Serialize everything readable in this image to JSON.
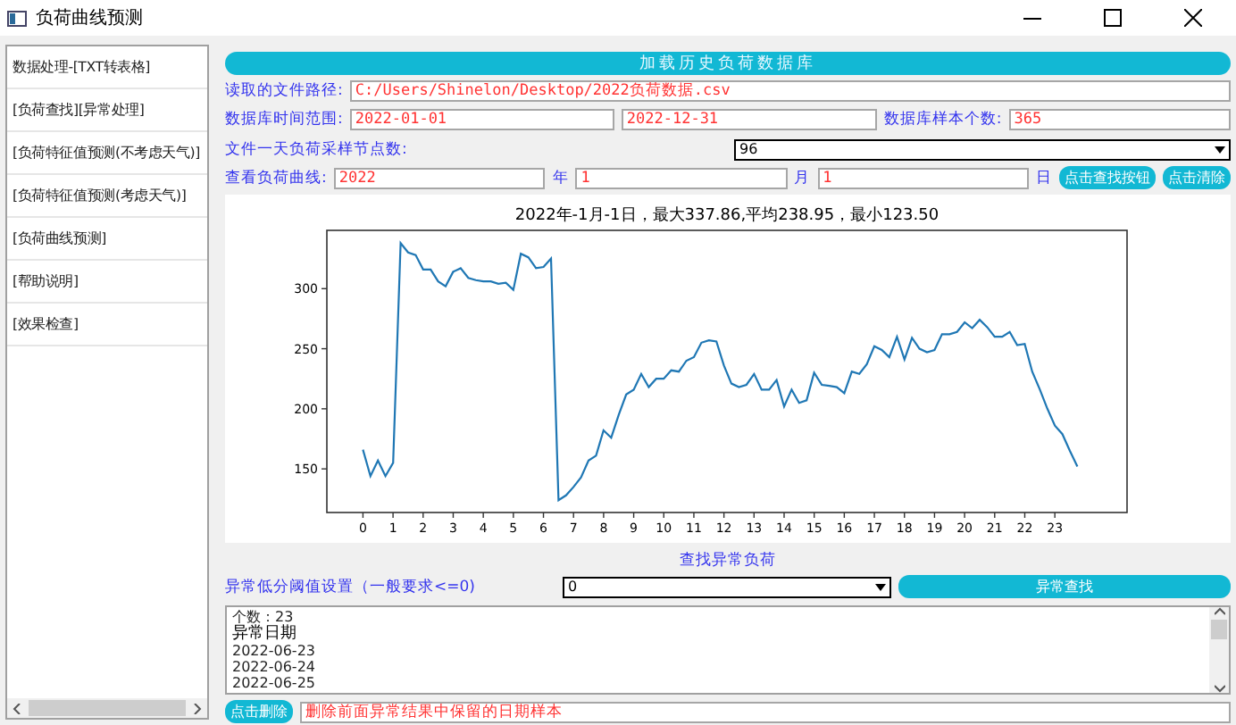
{
  "window": {
    "title": "负荷曲线预测"
  },
  "sidebar": {
    "items": [
      {
        "label": "数据处理-[TXT转表格]"
      },
      {
        "label": "[负荷查找][异常处理]"
      },
      {
        "label": "[负荷特征值预测(不考虑天气)]"
      },
      {
        "label": "[负荷特征值预测(考虑天气)]"
      },
      {
        "label": "[负荷曲线预测]"
      },
      {
        "label": "[帮助说明]"
      },
      {
        "label": "[效果检查]"
      }
    ]
  },
  "load_button": "加载历史负荷数据库",
  "file_path": {
    "label": "读取的文件路径:",
    "value": "C:/Users/Shinelon/Desktop/2022负荷数据.csv"
  },
  "date_range": {
    "label": "数据库时间范围:",
    "start": "2022-01-01",
    "end": "2022-12-31"
  },
  "sample_count": {
    "label": "数据库样本个数:",
    "value": "365"
  },
  "nodes": {
    "label": "文件一天负荷采样节点数:",
    "value": "96"
  },
  "curve": {
    "label": "查看负荷曲线:",
    "year": "2022",
    "year_unit": "年",
    "month": "1",
    "month_unit": "月",
    "day": "1",
    "day_unit": "日",
    "find_button": "点击查找按钮",
    "clear_button": "点击清除"
  },
  "chart": {
    "chart_data": {
      "type": "line",
      "title": "2022年-1月-1日，最大337.86,平均238.95，最小123.50",
      "x": [
        0,
        0.25,
        0.5,
        0.75,
        1,
        1.25,
        1.5,
        1.75,
        2,
        2.25,
        2.5,
        2.75,
        3,
        3.25,
        3.5,
        3.75,
        4,
        4.25,
        4.5,
        4.75,
        5,
        5.25,
        5.5,
        5.75,
        6,
        6.25,
        6.5,
        6.75,
        7,
        7.25,
        7.5,
        7.75,
        8,
        8.25,
        8.5,
        8.75,
        9,
        9.25,
        9.5,
        9.75,
        10,
        10.25,
        10.5,
        10.75,
        11,
        11.25,
        11.5,
        11.75,
        12,
        12.25,
        12.5,
        12.75,
        13,
        13.25,
        13.5,
        13.75,
        14,
        14.25,
        14.5,
        14.75,
        15,
        15.25,
        15.5,
        15.75,
        16,
        16.25,
        16.5,
        16.75,
        17,
        17.25,
        17.5,
        17.75,
        18,
        18.25,
        18.5,
        18.75,
        19,
        19.25,
        19.5,
        19.75,
        20,
        20.25,
        20.5,
        20.75,
        21,
        21.25,
        21.5,
        21.75,
        22,
        22.25,
        22.5,
        22.75,
        23,
        23.25,
        23.5,
        23.75
      ],
      "series": [
        {
          "color": "#1f77b4",
          "values": [
            166,
            144,
            157,
            144,
            155,
            338,
            330,
            328,
            316,
            316,
            306,
            302,
            314,
            317,
            309,
            307,
            306,
            306,
            304,
            305,
            299,
            329,
            326,
            317,
            318,
            325,
            124,
            128,
            135,
            143,
            157,
            161,
            182,
            176,
            195,
            212,
            216,
            229,
            218,
            225,
            225,
            232,
            231,
            240,
            243,
            255,
            257,
            256,
            236,
            221,
            218,
            220,
            229,
            216,
            216,
            224,
            202,
            216,
            205,
            207,
            230,
            220,
            219,
            218,
            213,
            231,
            229,
            237,
            252,
            249,
            243,
            260,
            241,
            259,
            250,
            247,
            249,
            262,
            262,
            264,
            272,
            267,
            274,
            268,
            260,
            260,
            264,
            253,
            254,
            231,
            216,
            200,
            186,
            179,
            165,
            152
          ]
        }
      ],
      "xlim": [
        -1.2,
        25.4
      ],
      "ylim": [
        113.7,
        348.5
      ],
      "xticks": [
        0,
        1,
        2,
        3,
        4,
        5,
        6,
        7,
        8,
        9,
        10,
        11,
        12,
        13,
        14,
        15,
        16,
        17,
        18,
        19,
        20,
        21,
        22,
        23
      ],
      "yticks": [
        150,
        200,
        250,
        300
      ]
    }
  },
  "anomaly": {
    "heading": "查找异常负荷",
    "threshold_label": "异常低分阈值设置（一般要求<=0)",
    "threshold_value": "0",
    "find_button": "异常查找",
    "results": [
      {
        "kind": "line",
        "text": "个数：23"
      },
      {
        "kind": "heading",
        "text": "异常日期"
      },
      {
        "kind": "line",
        "text": "2022-06-23"
      },
      {
        "kind": "line",
        "text": "2022-06-24"
      },
      {
        "kind": "line",
        "text": "2022-06-25"
      }
    ],
    "delete_button": "点击删除",
    "delete_field": "删除前面异常结果中保留的日期样本"
  }
}
